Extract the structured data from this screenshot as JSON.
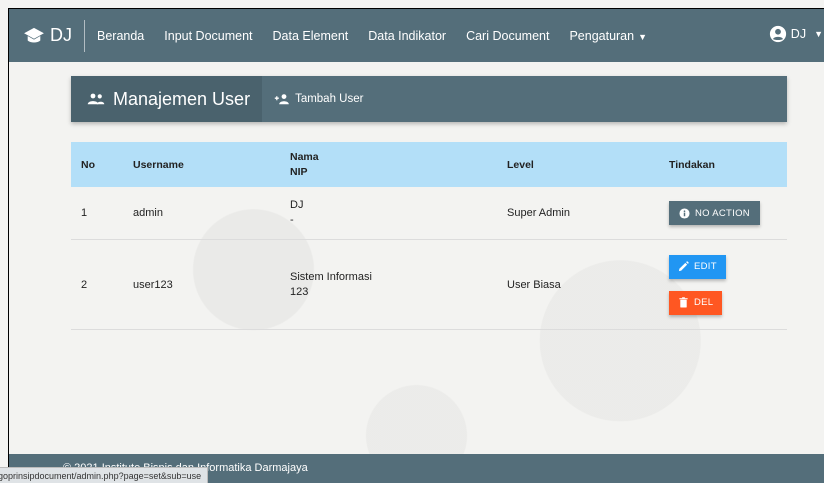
{
  "navbar": {
    "brand": "DJ",
    "items": [
      "Beranda",
      "Input Document",
      "Data Element",
      "Data Indikator",
      "Cari Document",
      "Pengaturan"
    ],
    "user": "DJ"
  },
  "panel": {
    "title": "Manajemen User",
    "add_label": "Tambah User"
  },
  "table": {
    "headers": {
      "no": "No",
      "username": "Username",
      "nama": "Nama",
      "nip": "NIP",
      "level": "Level",
      "tindakan": "Tindakan"
    },
    "rows": [
      {
        "no": "1",
        "username": "admin",
        "nama": "DJ",
        "nip": "-",
        "level": "Super Admin"
      },
      {
        "no": "2",
        "username": "user123",
        "nama": "Sistem Informasi",
        "nip": "123",
        "level": "User Biasa"
      }
    ],
    "actions": {
      "no_action": "NO ACTION",
      "edit": "EDIT",
      "del": "DEL"
    }
  },
  "footer": {
    "text": "© 2021 Institute Bisnis dan Informatika Darmajaya"
  },
  "status_bar": {
    "url": "goprinsipdocument/admin.php?page=set&sub=use"
  },
  "colors": {
    "primary": "#546e7a",
    "table_header": "#b3dff8",
    "edit": "#2196f3",
    "delete": "#ff5722"
  }
}
